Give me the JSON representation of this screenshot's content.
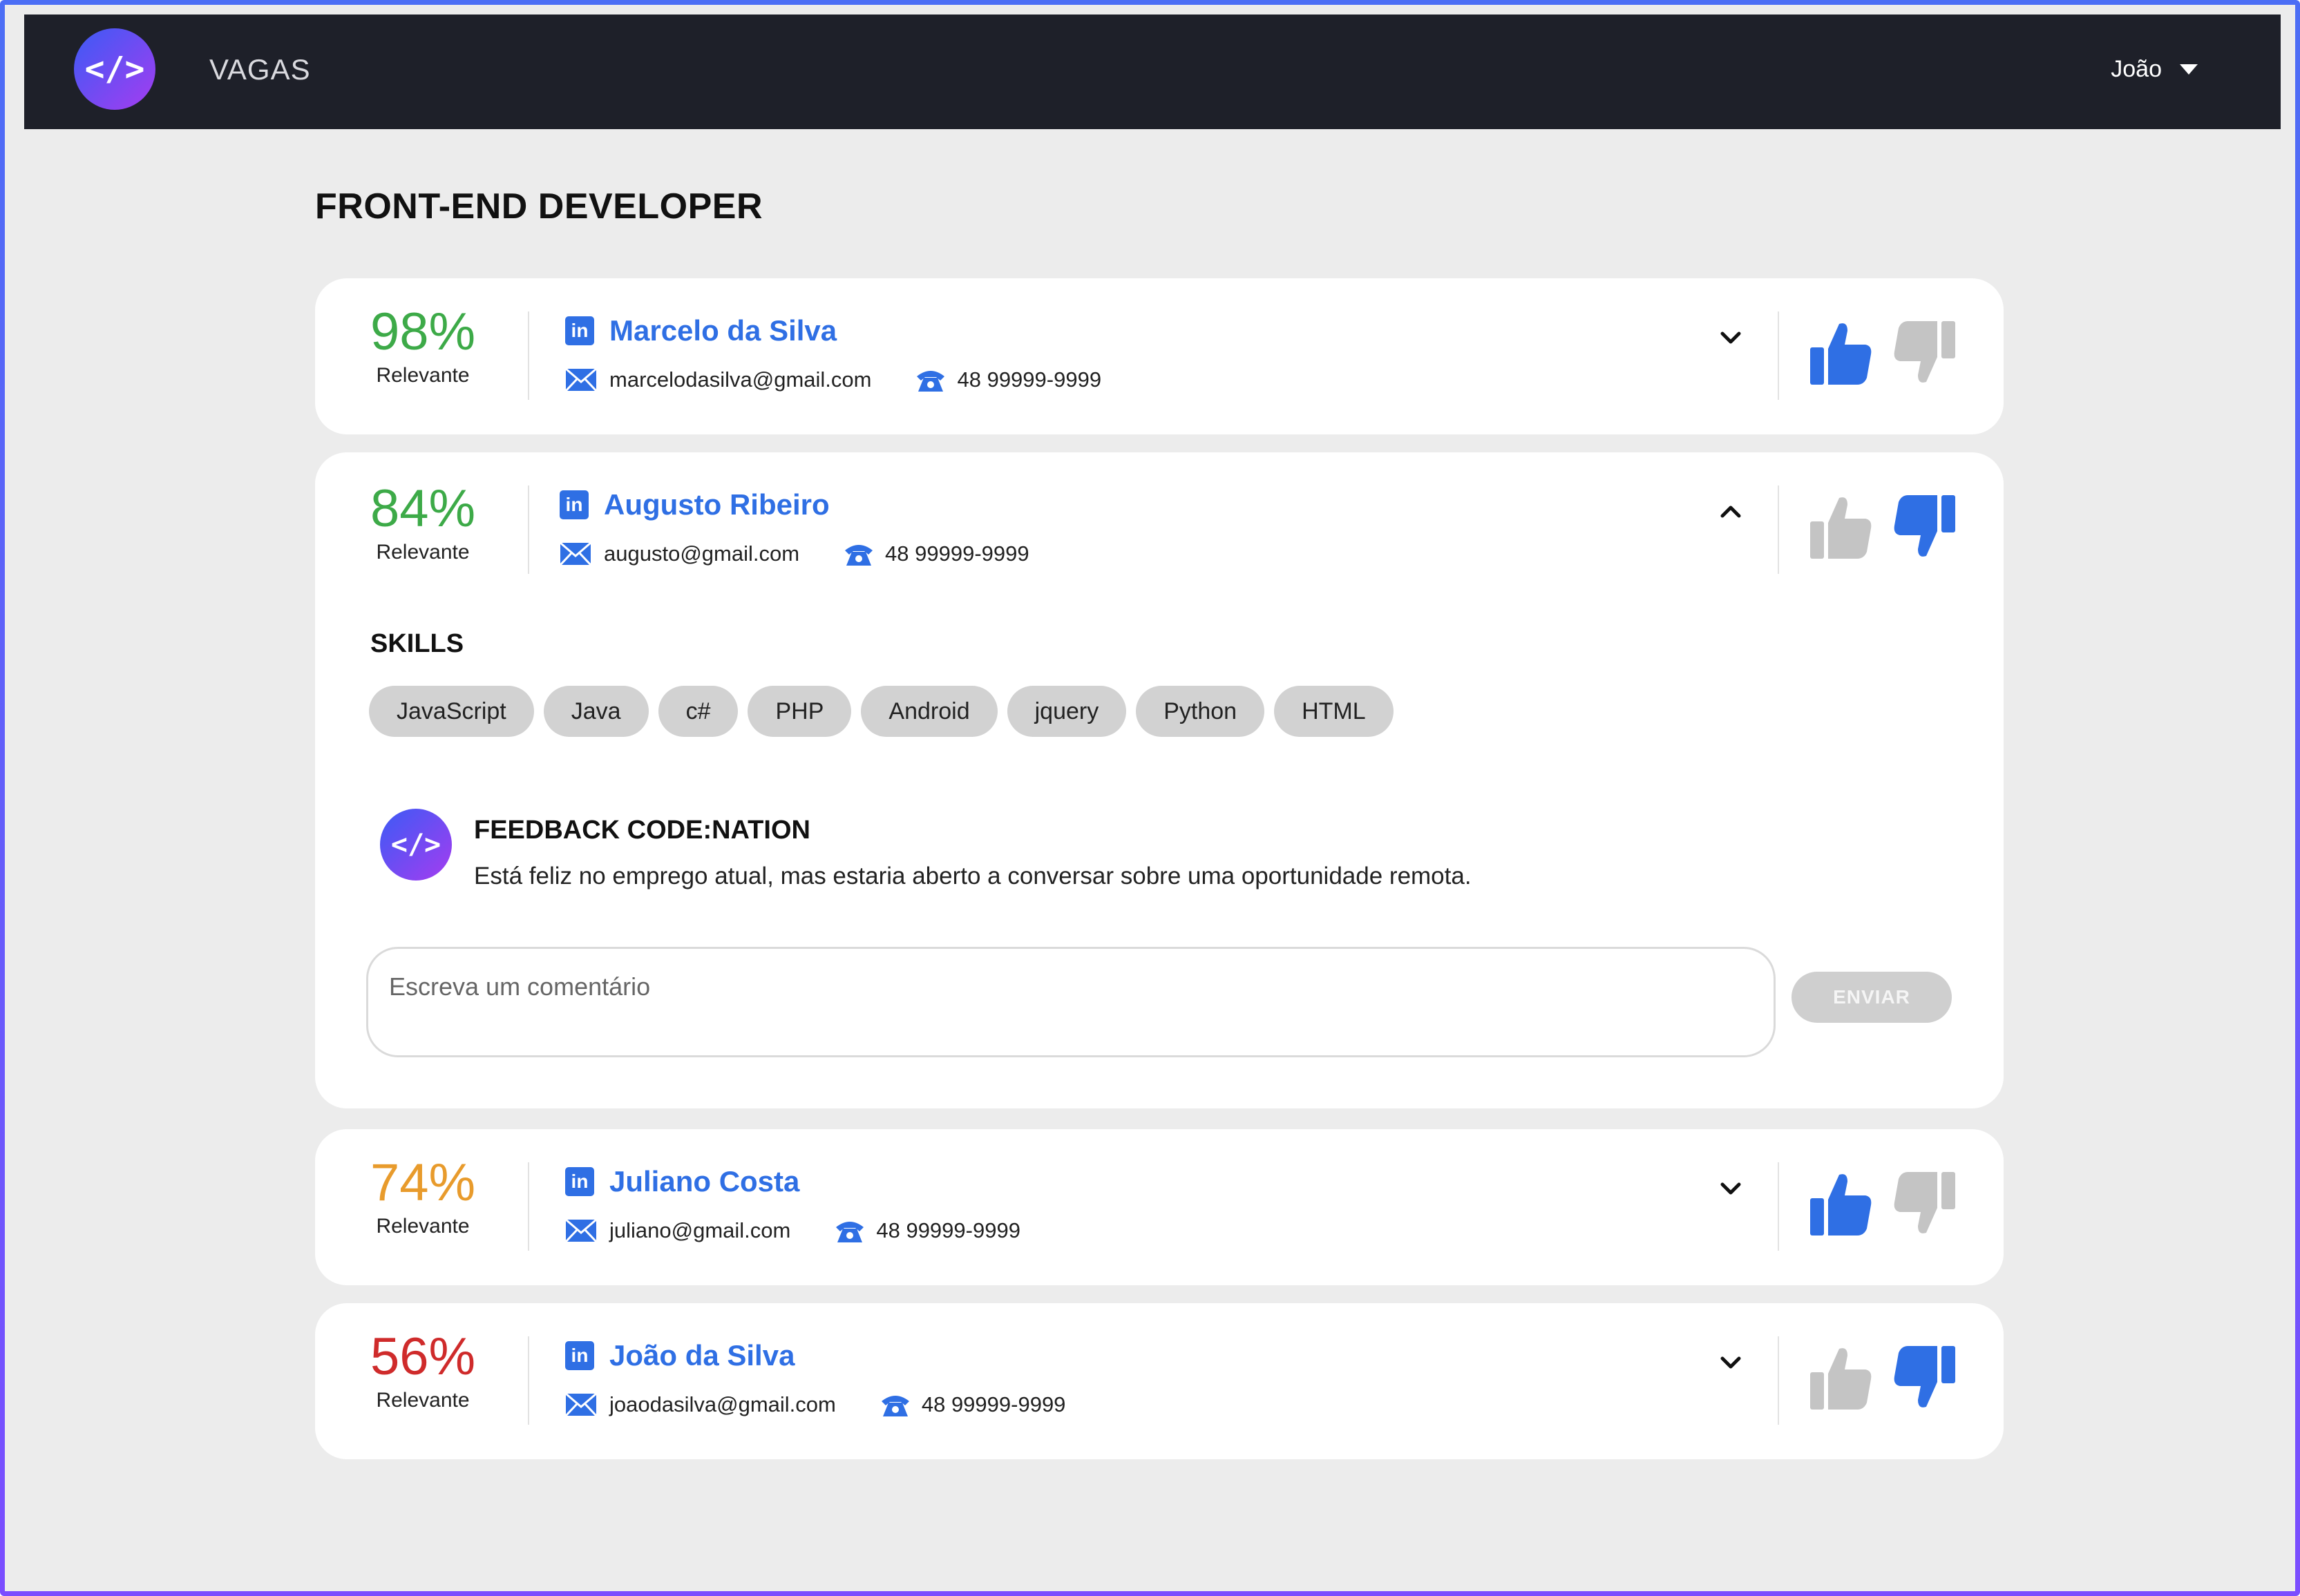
{
  "nav": {
    "brand": "VAGAS",
    "user": "João",
    "logo_text": "</>"
  },
  "page": {
    "title": "FRONT-END DEVELOPER"
  },
  "colors": {
    "accent": "#2f6fe4",
    "green": "#3daa48",
    "orange": "#e89b2c",
    "red": "#cf2b2b",
    "inactive": "#c4c4c4"
  },
  "candidates": [
    {
      "percent": "98%",
      "label": "Relevante",
      "name": "Marcelo da Silva",
      "email": "marcelodasilva@gmail.com",
      "phone": "48 99999-9999",
      "expanded": false,
      "vote": "up"
    },
    {
      "percent": "84%",
      "label": "Relevante",
      "name": "Augusto Ribeiro",
      "email": "augusto@gmail.com",
      "phone": "48 99999-9999",
      "expanded": true,
      "vote": "down"
    },
    {
      "percent": "74%",
      "label": "Relevante",
      "name": "Juliano Costa",
      "email": "juliano@gmail.com",
      "phone": "48 99999-9999",
      "expanded": false,
      "vote": "up"
    },
    {
      "percent": "56%",
      "label": "Relevante",
      "name": "João da Silva",
      "email": "joaodasilva@gmail.com",
      "phone": "48 99999-9999",
      "expanded": false,
      "vote": "down"
    }
  ],
  "details": {
    "skills_title": "SKILLS",
    "skills": [
      "JavaScript",
      "Java",
      "c#",
      "PHP",
      "Android",
      "jquery",
      "Python",
      "HTML"
    ],
    "feedback_title": "FEEDBACK CODE:NATION",
    "feedback_text": "Está feliz no emprego atual, mas estaria aberto a conversar sobre uma oportunidade remota.",
    "comment_placeholder": "Escreva um comentário",
    "send_label": "ENVIAR",
    "logo_text": "</>"
  },
  "icons": {
    "linkedin": "linkedin-icon",
    "mail": "mail-icon",
    "phone": "phone-icon",
    "chevron": "chevron-icon",
    "thumbs_up": "thumbs-up-icon",
    "thumbs_down": "thumbs-down-icon"
  }
}
